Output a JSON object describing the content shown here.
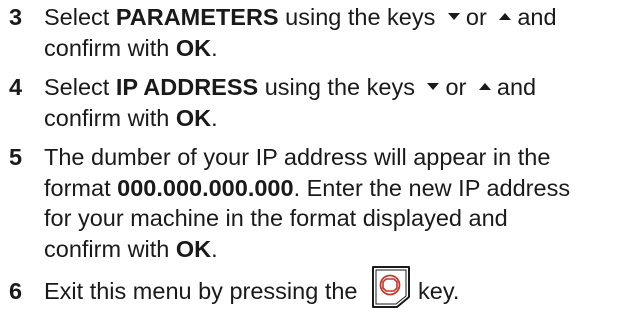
{
  "steps": [
    {
      "number": "3",
      "line1": {
        "a": "Select ",
        "b": "PARAMETERS",
        "c": " using the keys",
        "d": "or",
        "e": "and"
      },
      "line2": {
        "a": "confirm with ",
        "b": "OK",
        "c": "."
      }
    },
    {
      "number": "4",
      "line1": {
        "a": "Select ",
        "b": "IP ADDRESS",
        "c": " using the keys",
        "d": "or",
        "e": "and"
      },
      "line2": {
        "a": "confirm with ",
        "b": "OK",
        "c": "."
      }
    },
    {
      "number": "5",
      "line1": "The dumber of your IP address will appear in the",
      "line2": {
        "a": "format ",
        "b": "000.000.000.000",
        "c": ". Enter the new IP address"
      },
      "line3": "for your machine in the format displayed and",
      "line4": {
        "a": "confirm with ",
        "b": "OK",
        "c": "."
      }
    },
    {
      "number": "6",
      "line1": {
        "a": "Exit this menu by pressing the ",
        "b": "key."
      }
    }
  ],
  "icons": {
    "down_arrow": "down-arrow-key-icon",
    "up_arrow": "up-arrow-key-icon",
    "stop_key": "stop-key-icon",
    "stop_color": "#c0392b"
  }
}
